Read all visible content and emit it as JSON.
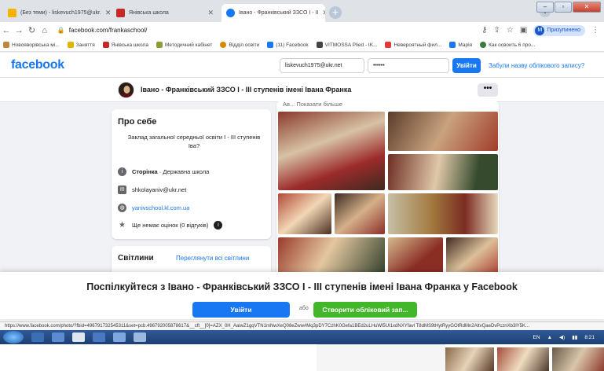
{
  "browser": {
    "tabs": [
      {
        "label": "(Без теми) - liskevuch1975@ukr.",
        "active": false
      },
      {
        "label": "Янівська школа",
        "active": false
      },
      {
        "label": "Івано - Франківський ЗЗСО І - ІІ",
        "active": true
      }
    ],
    "new_tab": "+",
    "url": "facebook.com/frankaschool/",
    "profile_status": "Призупинено",
    "profile_initial": "М",
    "bookmarks": [
      "Новояворівська мі...",
      "Заняття",
      "Янівська школа",
      "Методичний кабінет",
      "Відділ освіти",
      "(11) Facebook",
      "VITMOSSA Plied - IK...",
      "Невероятный фил...",
      "Марія",
      "Как освоить 6 про..."
    ]
  },
  "facebook": {
    "logo": "facebook",
    "email_value": "liskevuch1975@ukr.net",
    "password_value": "••••••",
    "login_button": "Увійти",
    "forgot_link": "Забули назву облікового запису?",
    "page_name": "Івано - Франківський ЗЗСО І - ІІІ ступенів імені Івана Франка",
    "more_button": "•••",
    "about": {
      "title": "Про себе",
      "intro": "Заклад загальної середньої освіти І - ІІІ ступенів Іва?",
      "category_prefix": "Сторінка",
      "category": " · Державна школа",
      "email": "shkolayaniv@ukr.net",
      "website": "yanivschool.kl.com.ua",
      "rating": "Ще немає оцінок (0 відгуків)"
    },
    "photos": {
      "title": "Світлини",
      "see_all": "Переглянути всі світлини"
    },
    "post_show_more": "Ав... Показати більше",
    "overlay": {
      "cta": "Поспілкуйтеся з Івано - Франківський ЗЗСО І - ІІІ ступенів імені Івана Франка у Facebook",
      "login": "Увійти",
      "or": "або",
      "create": "Створити обліковий зап..."
    }
  },
  "status_url": "https://www.facebook.com/photo/?fbid=496791732545311&set=pcb.496792005878617&__cft__[0]=AZX_0H_AaiwZ1gqVTN1mNwXeQ08eZww#Mq3pDY7CzhK0Gefa1BEd2uLHuWl5UI1xdNXYfavl T8dMS9tHytRyyGOtRdMn2AltvQaeDvPcznXb3lY5K...",
  "taskbar": {
    "lang": "EN",
    "time": "8:21"
  },
  "colors": {
    "facebook_blue": "#1877f2",
    "create_green": "#42b72a"
  }
}
